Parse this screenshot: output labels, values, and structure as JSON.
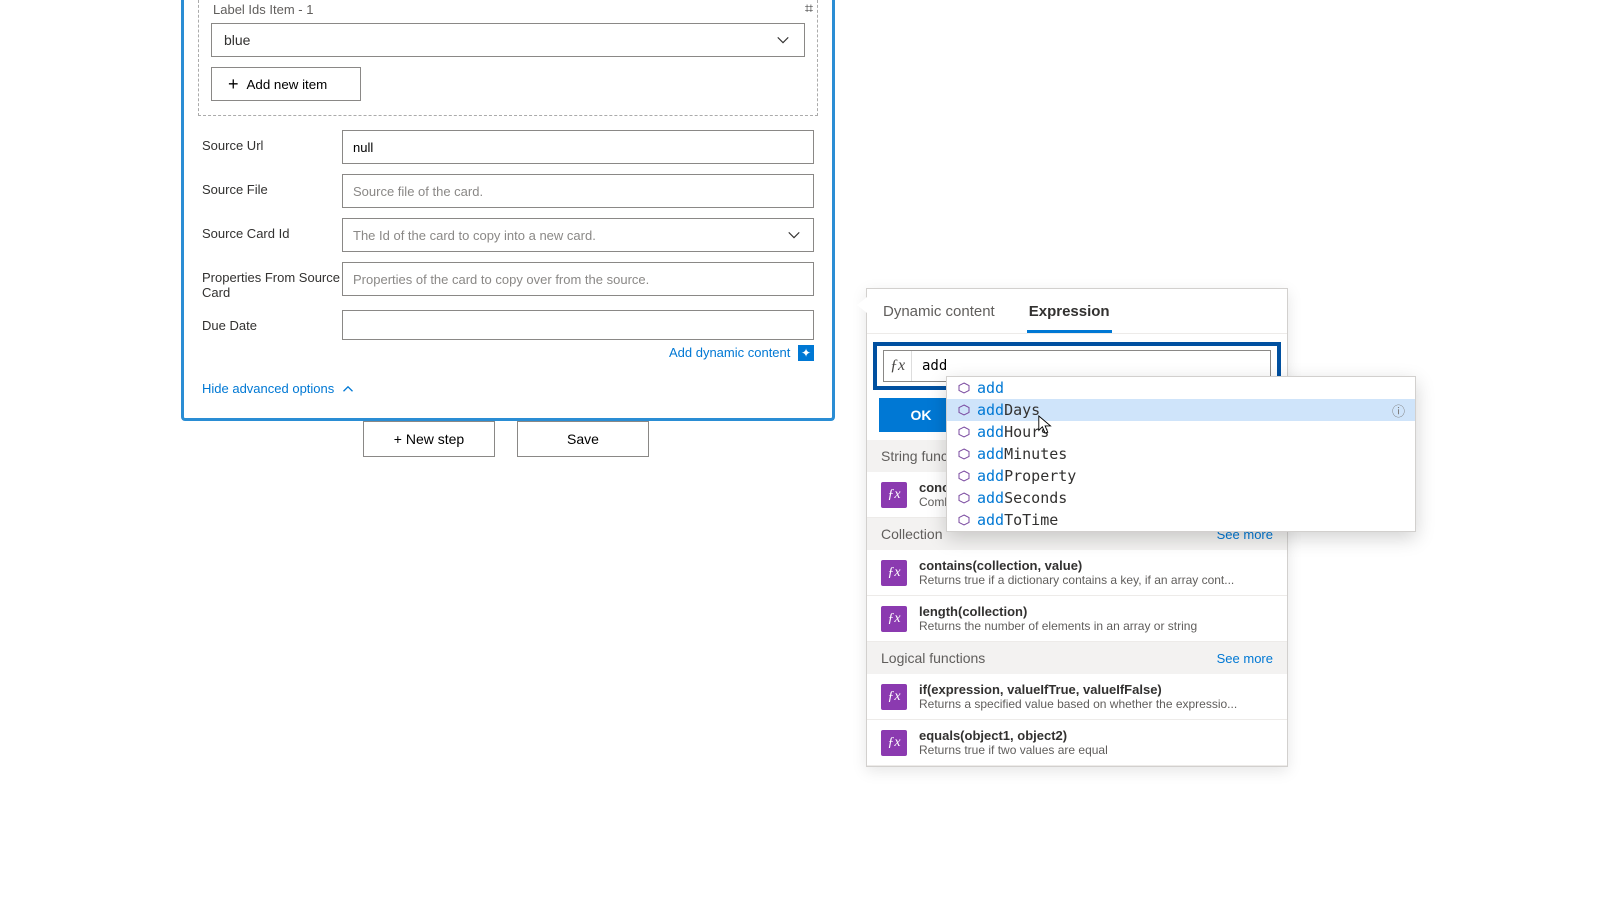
{
  "label_ids": {
    "title": "Label Ids Item - 1",
    "value": "blue",
    "add_new": "Add new item"
  },
  "fields": {
    "source_url": {
      "label": "Source Url",
      "value": "null"
    },
    "source_file": {
      "label": "Source File",
      "placeholder": "Source file of the card."
    },
    "source_card_id": {
      "label": "Source Card Id",
      "placeholder": "The Id of the card to copy into a new card."
    },
    "props": {
      "label": "Properties From Source Card",
      "placeholder": "Properties of the card to copy over from the source."
    },
    "due_date": {
      "label": "Due Date"
    }
  },
  "add_dynamic": "Add dynamic content",
  "hide_adv": "Hide advanced options",
  "buttons": {
    "new_step": "+ New step",
    "save": "Save"
  },
  "panel": {
    "tab_dynamic": "Dynamic content",
    "tab_expression": "Expression",
    "expr_value": "add",
    "ok": "OK",
    "sections": {
      "string": "String funct",
      "collection": "Collection",
      "logical": "Logical functions"
    },
    "see_more": "See more",
    "fns": {
      "concat_sig": "conca",
      "concat_desc": "Comb",
      "contains_sig": "contains(collection, value)",
      "contains_desc": "Returns true if a dictionary contains a key, if an array cont...",
      "length_sig": "length(collection)",
      "length_desc": "Returns the number of elements in an array or string",
      "if_sig": "if(expression, valueIfTrue, valueIfFalse)",
      "if_desc": "Returns a specified value based on whether the expressio...",
      "equals_sig": "equals(object1, object2)",
      "equals_desc": "Returns true if two values are equal"
    }
  },
  "autocomplete": {
    "prefix": "add",
    "items": [
      {
        "suffix": ""
      },
      {
        "suffix": "Days"
      },
      {
        "suffix": "Hours"
      },
      {
        "suffix": "Minutes"
      },
      {
        "suffix": "Property"
      },
      {
        "suffix": "Seconds"
      },
      {
        "suffix": "ToTime"
      }
    ],
    "selected_index": 1
  }
}
